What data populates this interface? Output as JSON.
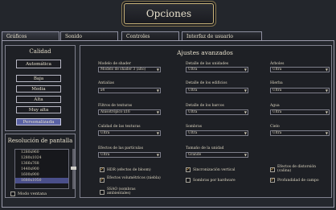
{
  "window_title": "Opciones",
  "tabs": [
    {
      "label": "Gráficos"
    },
    {
      "label": "Sonido"
    },
    {
      "label": "Controles"
    },
    {
      "label": "Interfaz de usuario"
    }
  ],
  "quality": {
    "heading": "Calidad",
    "auto_label": "Automática",
    "options": [
      "Baja",
      "Media",
      "Alta",
      "Muy alta"
    ],
    "custom_label": "Personalizada"
  },
  "resolution": {
    "heading": "Resolución de pantalla",
    "items": [
      "1280x960",
      "1280x1024",
      "1366x768",
      "1440x900",
      "1600x900",
      "1680x1050"
    ],
    "selected": "1680x1050",
    "windowed_label": "Modo ventana"
  },
  "advanced": {
    "heading": "Ajustes avanzados",
    "settings": [
      {
        "label": "Modelo de shader",
        "value": "Modelo de shader 3 (alto)"
      },
      {
        "label": "Detalle de las unidades",
        "value": "Ultra"
      },
      {
        "label": "Árboles",
        "value": "Ultra"
      },
      {
        "label": "Antialias",
        "value": "x4"
      },
      {
        "label": "Detalle de los edificios",
        "value": "Ultra"
      },
      {
        "label": "Hierba",
        "value": "Ultra"
      },
      {
        "label": "Filtros de texturas",
        "value": "Anisotrópico x16"
      },
      {
        "label": "Detalle de los barcos",
        "value": "Ultra"
      },
      {
        "label": "Agua",
        "value": "Ultra"
      },
      {
        "label": "Calidad de las texturas",
        "value": "Ultra"
      },
      {
        "label": "Sombras",
        "value": "Ultra"
      },
      {
        "label": "Cielo",
        "value": "Ultra"
      },
      {
        "label": "Efectos de las partículas",
        "value": "Ultra"
      },
      {
        "label": "Tamaño de la unidad",
        "value": "Grande"
      }
    ],
    "checkboxes": [
      {
        "label": "HDR (efectos de bloom)",
        "checked": true
      },
      {
        "label": "Sincronización vertical",
        "checked": true
      },
      {
        "label": "Efectos de distorsión (calina)",
        "checked": true
      },
      {
        "label": "Efectos volumétricos (niebla)",
        "checked": true
      },
      {
        "label": "Sombras por hardware",
        "checked": false
      },
      {
        "label": "Profundidad de campo",
        "checked": true
      },
      {
        "label": "SSAO (sombras ambientales)",
        "checked": false
      }
    ]
  },
  "colors": {
    "accent": "#5a62a4",
    "check": "#e0a33c",
    "frame": "#9a9aaa"
  }
}
